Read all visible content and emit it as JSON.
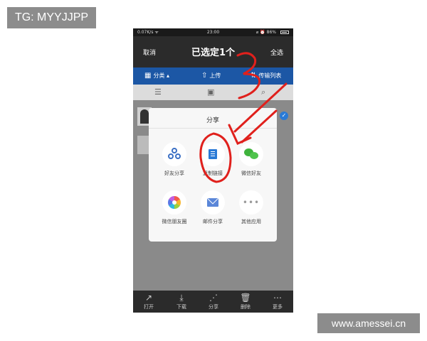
{
  "watermarks": {
    "top": "TG: MYYJJPP",
    "bottom": "www.amessei.cn"
  },
  "statusbar": {
    "left": "0.07K/s ᯤ",
    "time": "23:00",
    "right": "⌀ ⏰ 86%"
  },
  "topbar": {
    "cancel": "取消",
    "title": "已选定1个",
    "select_all": "全选"
  },
  "tabs": [
    {
      "icon": "▦",
      "label": "分类 ▴"
    },
    {
      "icon": "⇧",
      "label": "上传"
    },
    {
      "icon": "⇅",
      "label": "传输列表"
    }
  ],
  "view_icons": {
    "list": "☰",
    "folder": "▣",
    "search": "⌕"
  },
  "list_check": "✓",
  "share_dialog": {
    "title": "分享",
    "options": [
      {
        "label": "好友分享",
        "icon": "friend-share-icon"
      },
      {
        "label": "复制链接",
        "icon": "copy-link-icon"
      },
      {
        "label": "微信好友",
        "icon": "wechat-icon"
      },
      {
        "label": "微信朋友圈",
        "icon": "moments-icon"
      },
      {
        "label": "邮件分享",
        "icon": "mail-icon"
      },
      {
        "label": "其他应用",
        "icon": "more-icon"
      }
    ],
    "more_dots": "•••"
  },
  "bottombar": [
    {
      "icon": "↗",
      "label": "打开"
    },
    {
      "icon": "⤓",
      "label": "下载"
    },
    {
      "icon": "⋰",
      "label": "分享"
    },
    {
      "icon": "🗑",
      "label": "删除"
    },
    {
      "icon": "⋯",
      "label": "更多"
    }
  ],
  "colors": {
    "accent": "#1c57a5",
    "annotation": "#e0201c",
    "overlay": "#8a8a8a"
  }
}
